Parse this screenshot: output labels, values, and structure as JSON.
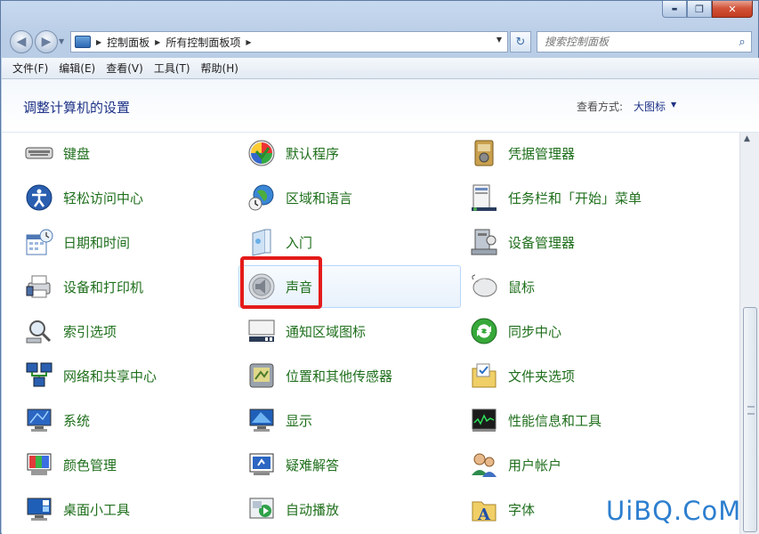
{
  "window": {
    "minimize_glyph": "▬",
    "maximize_glyph": "❐",
    "close_glyph": "✕"
  },
  "address": {
    "crumbs": [
      "控制面板",
      "所有控制面板项"
    ],
    "search_placeholder": "搜索控制面板"
  },
  "menu": [
    "文件(F)",
    "编辑(E)",
    "查看(V)",
    "工具(T)",
    "帮助(H)"
  ],
  "header": {
    "title": "调整计算机的设置",
    "view_label": "查看方式:",
    "view_value": "大图标"
  },
  "items": [
    {
      "label": "键盘",
      "icon": "keyboard-icon"
    },
    {
      "label": "默认程序",
      "icon": "default-programs-icon"
    },
    {
      "label": "凭据管理器",
      "icon": "credential-manager-icon"
    },
    {
      "label": "轻松访问中心",
      "icon": "ease-of-access-icon"
    },
    {
      "label": "区域和语言",
      "icon": "region-language-icon"
    },
    {
      "label": "任务栏和「开始」菜单",
      "icon": "taskbar-start-menu-icon"
    },
    {
      "label": "日期和时间",
      "icon": "date-time-icon"
    },
    {
      "label": "入门",
      "icon": "getting-started-icon"
    },
    {
      "label": "设备管理器",
      "icon": "device-manager-icon"
    },
    {
      "label": "设备和打印机",
      "icon": "devices-printers-icon"
    },
    {
      "label": "声音",
      "icon": "sound-icon"
    },
    {
      "label": "鼠标",
      "icon": "mouse-icon"
    },
    {
      "label": "索引选项",
      "icon": "indexing-options-icon"
    },
    {
      "label": "通知区域图标",
      "icon": "notification-area-icon"
    },
    {
      "label": "同步中心",
      "icon": "sync-center-icon"
    },
    {
      "label": "网络和共享中心",
      "icon": "network-sharing-icon"
    },
    {
      "label": "位置和其他传感器",
      "icon": "location-sensors-icon"
    },
    {
      "label": "文件夹选项",
      "icon": "folder-options-icon"
    },
    {
      "label": "系统",
      "icon": "system-icon"
    },
    {
      "label": "显示",
      "icon": "display-icon"
    },
    {
      "label": "性能信息和工具",
      "icon": "performance-icon"
    },
    {
      "label": "颜色管理",
      "icon": "color-management-icon"
    },
    {
      "label": "疑难解答",
      "icon": "troubleshooting-icon"
    },
    {
      "label": "用户帐户",
      "icon": "user-accounts-icon"
    },
    {
      "label": "桌面小工具",
      "icon": "desktop-gadgets-icon"
    },
    {
      "label": "自动播放",
      "icon": "autoplay-icon"
    },
    {
      "label": "字体",
      "icon": "fonts-icon"
    }
  ],
  "watermark": "UiBQ.CoM"
}
